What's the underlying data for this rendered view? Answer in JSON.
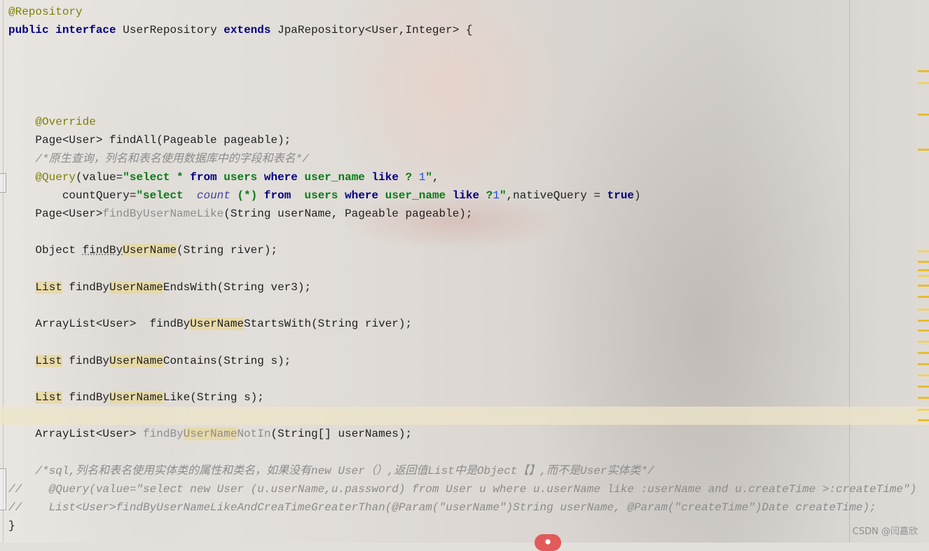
{
  "editor": {
    "lines": [
      {
        "tokens": [
          {
            "t": "@Repository",
            "c": "ann"
          }
        ]
      },
      {
        "tokens": [
          {
            "t": "public",
            "c": "kw"
          },
          {
            "t": " "
          },
          {
            "t": "interface",
            "c": "kw"
          },
          {
            "t": " UserRepository "
          },
          {
            "t": "extends",
            "c": "kw"
          },
          {
            "t": " JpaRepository<User,Integer> {"
          }
        ]
      },
      {
        "tokens": []
      },
      {
        "tokens": []
      },
      {
        "tokens": []
      },
      {
        "tokens": []
      },
      {
        "tokens": [
          {
            "t": "    "
          },
          {
            "t": "@Override",
            "c": "ann"
          }
        ]
      },
      {
        "tokens": [
          {
            "t": "    Page<User> findAll(Pageable pageable);"
          }
        ]
      },
      {
        "tokens": [
          {
            "t": "    "
          },
          {
            "t": "/*原生查询，列名和表名使用数据库中的字段和表名*/",
            "c": "cmt"
          }
        ]
      },
      {
        "tokens": [
          {
            "t": "    "
          },
          {
            "t": "@Query",
            "c": "ann"
          },
          {
            "t": "(value="
          },
          {
            "t": "\"select * ",
            "c": "str"
          },
          {
            "t": "from",
            "c": "kw"
          },
          {
            "t": " users ",
            "c": "str"
          },
          {
            "t": "where",
            "c": "kw"
          },
          {
            "t": " user_name ",
            "c": "str"
          },
          {
            "t": "like",
            "c": "kw"
          },
          {
            "t": " ? ",
            "c": "str"
          },
          {
            "t": "1",
            "c": "num"
          },
          {
            "t": "\"",
            "c": "str"
          },
          {
            "t": ","
          }
        ]
      },
      {
        "tokens": [
          {
            "t": "        countQuery="
          },
          {
            "t": "\"select  ",
            "c": "str"
          },
          {
            "t": "count",
            "c": "ital"
          },
          {
            "t": " (*) ",
            "c": "str"
          },
          {
            "t": "from",
            "c": "kw"
          },
          {
            "t": "  users ",
            "c": "str"
          },
          {
            "t": "where",
            "c": "kw"
          },
          {
            "t": " user_name ",
            "c": "str"
          },
          {
            "t": "like",
            "c": "kw"
          },
          {
            "t": " ?",
            "c": "str"
          },
          {
            "t": "1",
            "c": "num"
          },
          {
            "t": "\"",
            "c": "str"
          },
          {
            "t": ",nativeQuery = "
          },
          {
            "t": "true",
            "c": "kw"
          },
          {
            "t": ")"
          }
        ]
      },
      {
        "tokens": [
          {
            "t": "    Page<User>"
          },
          {
            "t": "findByUserNameLike",
            "c": "muted"
          },
          {
            "t": "(String userName, Pageable pageable);"
          }
        ]
      },
      {
        "tokens": []
      },
      {
        "tokens": [
          {
            "t": "    Object "
          },
          {
            "t": "findBy",
            "c": "und"
          },
          {
            "t": "UserName",
            "c": "hl"
          },
          {
            "t": "(String river);"
          }
        ]
      },
      {
        "tokens": []
      },
      {
        "tokens": [
          {
            "t": "    "
          },
          {
            "t": "List",
            "c": "hl"
          },
          {
            "t": " findBy"
          },
          {
            "t": "UserName",
            "c": "hl"
          },
          {
            "t": "EndsWith(String ver3);"
          }
        ]
      },
      {
        "tokens": []
      },
      {
        "tokens": [
          {
            "t": "    ArrayList<User>  findBy"
          },
          {
            "t": "UserName",
            "c": "hl"
          },
          {
            "t": "StartsWith(String river);"
          }
        ]
      },
      {
        "tokens": []
      },
      {
        "tokens": [
          {
            "t": "    "
          },
          {
            "t": "List",
            "c": "hl"
          },
          {
            "t": " findBy"
          },
          {
            "t": "UserName",
            "c": "hl"
          },
          {
            "t": "Contains(String s);"
          }
        ]
      },
      {
        "tokens": []
      },
      {
        "tokens": [
          {
            "t": "    "
          },
          {
            "t": "List",
            "c": "hl"
          },
          {
            "t": " findBy"
          },
          {
            "t": "UserName",
            "c": "hl"
          },
          {
            "t": "Like(String s);"
          }
        ]
      },
      {
        "tokens": [],
        "current": true
      },
      {
        "tokens": [
          {
            "t": "    ArrayList<User> "
          },
          {
            "t": "findBy",
            "c": "muted"
          },
          {
            "t": "UserName",
            "c": "hl muted"
          },
          {
            "t": "NotIn",
            "c": "muted"
          },
          {
            "t": "(String[] userNames);"
          }
        ]
      },
      {
        "tokens": []
      },
      {
        "tokens": [
          {
            "t": "    "
          },
          {
            "t": "/*sql,列名和表名使用实体类的属性和类名，如果没有new User（）,返回值List中是Object【】,而不是User实体类*/",
            "c": "cmt"
          }
        ]
      },
      {
        "tokens": [
          {
            "t": "//    @Query(value=\"select new User (u.userName,u.password) from User u where u.userName like :userName and u.createTime >:createTime\")",
            "c": "cmt"
          }
        ]
      },
      {
        "tokens": [
          {
            "t": "//    List<User>findByUserNameLikeAndCreaTimeGreaterThan(@Param(\"userName\")String userName, @Param(\"createTime\")Date createTime);",
            "c": "cmt"
          }
        ]
      },
      {
        "tokens": [
          {
            "t": "}"
          }
        ]
      }
    ]
  },
  "watermark": "CSDN @闫嘉欣",
  "colors": {
    "keyword": "#000080",
    "annotation": "#808000",
    "string": "#067d17",
    "number": "#1750eb",
    "comment": "#8c8c8c",
    "highlight": "#e8d8a0",
    "marker": "#e8bd2c"
  }
}
